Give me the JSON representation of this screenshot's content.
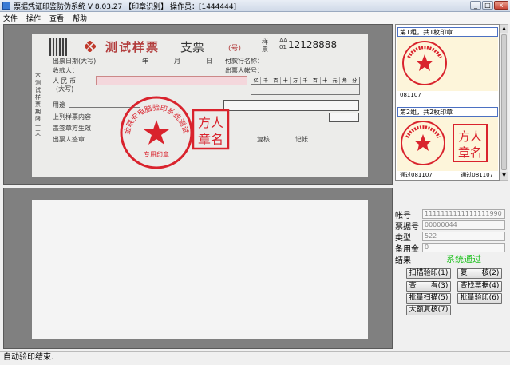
{
  "window": {
    "title": "票据凭证印鉴防伪系统 V 8.03.27 【印章识别】 操作员：[1444444]"
  },
  "menu": [
    "文件",
    "操作",
    "查看",
    "帮助"
  ],
  "cheque": {
    "title": "测试样票",
    "type": "支票",
    "number_label": "(号)",
    "sample_label": "样票",
    "serial_prefix": "AA 01",
    "serial": "12128888",
    "date_label": "出票日期(大写)",
    "year": "年",
    "month": "月",
    "day": "日",
    "payee_label": "收款人：",
    "pay_bank_label": "付款行名称：",
    "drawer_account_label": "出票人帐号：",
    "currency_label": "人 民 币",
    "currency_sub": "(大写)",
    "amount_units": [
      "亿",
      "千",
      "百",
      "十",
      "万",
      "千",
      "百",
      "十",
      "元",
      "角",
      "分"
    ],
    "purpose_label": "用途",
    "above_label": "上列样票内容",
    "seal_label": "盖签章方生效",
    "drawer_sign_label": "出票人签章",
    "review_label": "复核",
    "record_label": "记帐",
    "side_text": "本测试样票期限十天",
    "round_stamp_text": "金联安电脑验印系统测试",
    "round_stamp_bottom": "专用印章",
    "square_stamp_text": [
      "方人",
      "章名"
    ]
  },
  "previews": [
    {
      "header": "第1组，共1枚印章",
      "captions": [
        "081107"
      ]
    },
    {
      "header": "第2组，共2枚印章",
      "captions": [
        "通过081107",
        "通过081107"
      ]
    }
  ],
  "info": {
    "account_label": "帐号",
    "account_value": "1111111111111111990",
    "ticket_no_label": "票据号",
    "ticket_no_value": "00000044",
    "type_label": "类型",
    "type_value": "522",
    "reserve_label": "备用金",
    "reserve_value": "0",
    "result_label": "结果",
    "result_value": "系统通过"
  },
  "buttons": {
    "scan_verify": "扫描验印(1)",
    "recheck": "复　　核(2)",
    "view": "查　　看(3)",
    "find_ticket": "查找票据(4)",
    "batch_scan": "批量扫描(5)",
    "batch_verify": "批量验印(6)",
    "large_recheck": "大额复核(7)"
  },
  "status": "自动验印结束."
}
